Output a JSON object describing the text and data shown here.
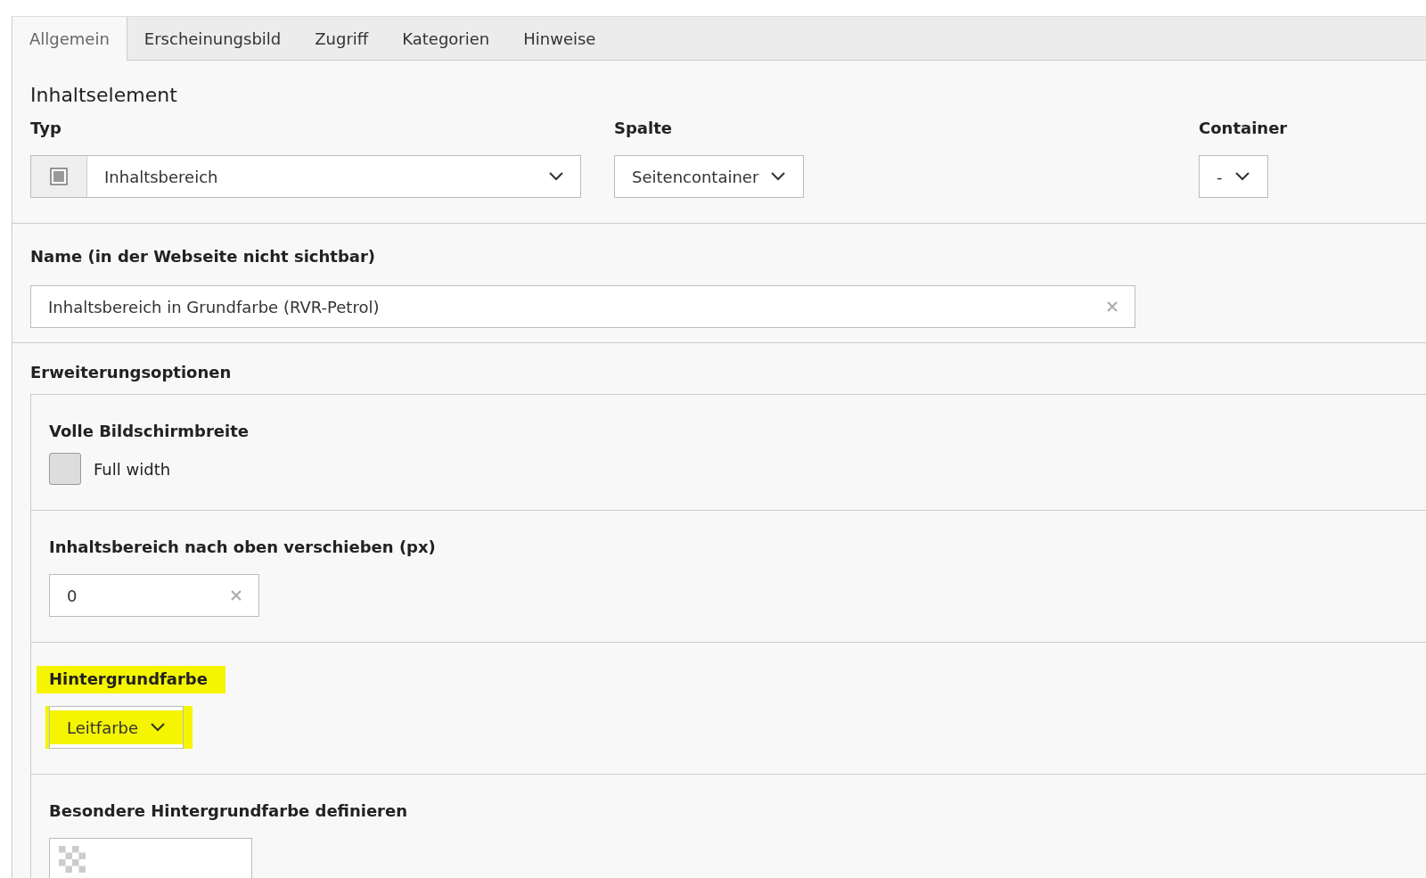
{
  "tabs": [
    {
      "label": "Allgemein",
      "selected": true
    },
    {
      "label": "Erscheinungsbild",
      "selected": false
    },
    {
      "label": "Zugriff",
      "selected": false
    },
    {
      "label": "Kategorien",
      "selected": false
    },
    {
      "label": "Hinweise",
      "selected": false
    }
  ],
  "header": "Inhaltselement",
  "type_row": [
    {
      "label": "Typ",
      "value": "Inhaltsbereich",
      "kind": "icon-select"
    },
    {
      "label": "Spalte",
      "value": "Seitencontainer",
      "kind": "select"
    },
    {
      "label": "Container",
      "value": "-",
      "kind": "select"
    }
  ],
  "name_field": {
    "label": "Name (in der Webseite nicht sichtbar)",
    "value": "Inhaltsbereich in Grundfarbe (RVR-Petrol)"
  },
  "extension": {
    "title": "Erweiterungsoptionen",
    "fields": [
      {
        "kind": "checkbox",
        "label": "Volle Bildschirmbreite",
        "option": "Full width",
        "checked": false,
        "highlighted": false
      },
      {
        "kind": "text",
        "label": "Inhaltsbereich nach oben verschieben (px)",
        "value": "0",
        "highlighted": false
      },
      {
        "kind": "select",
        "label": "Hintergrundfarbe",
        "value": "Leitfarbe",
        "highlighted": true
      },
      {
        "kind": "color",
        "label": "Besondere Hintergrundfarbe definieren",
        "highlighted": false
      }
    ]
  }
}
